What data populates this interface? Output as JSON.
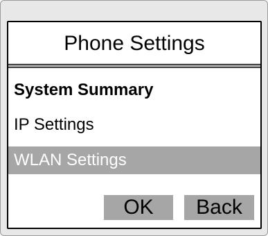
{
  "title": "Phone Settings",
  "menu": {
    "items": [
      {
        "label": "System Summary"
      },
      {
        "label": "IP Settings"
      },
      {
        "label": "WLAN Settings"
      }
    ],
    "selected_index": 2
  },
  "softkeys": {
    "ok_label": "OK",
    "back_label": "Back"
  },
  "colors": {
    "selection": "#a6a6a6",
    "softkey": "#a6a6a6",
    "border": "#000000"
  }
}
